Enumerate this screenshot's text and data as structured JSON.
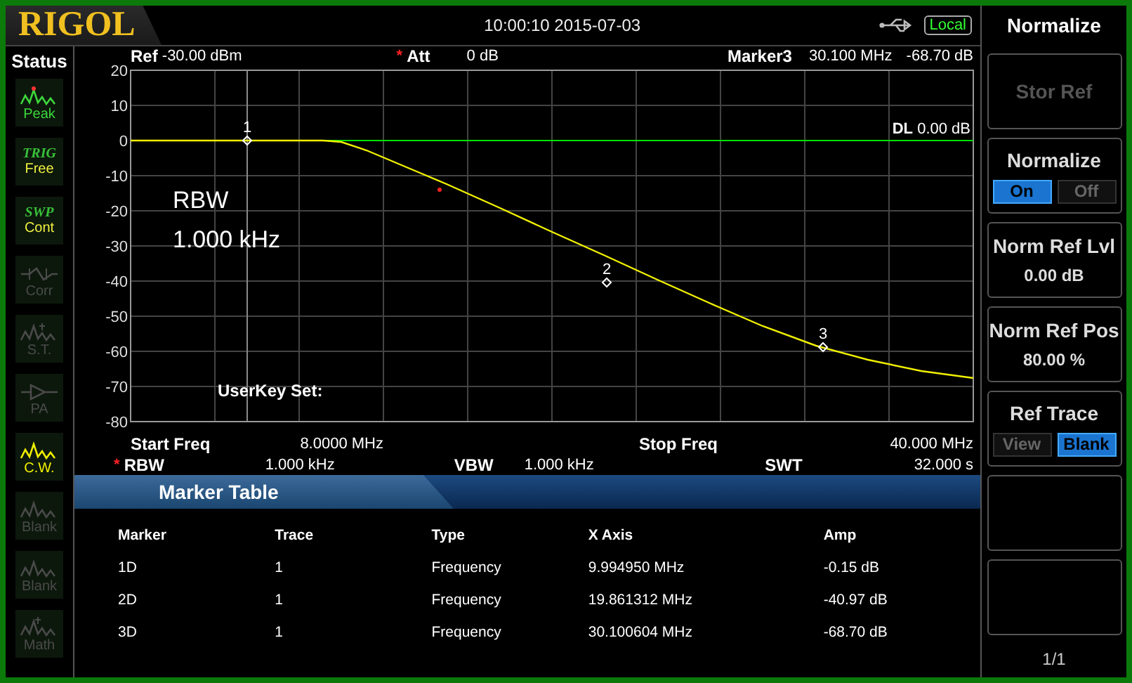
{
  "header": {
    "logo": "RIGOL",
    "datetime": "10:00:10 2015-07-03",
    "remote": "Local"
  },
  "status": {
    "title": "Status",
    "items": [
      {
        "label": "Peak",
        "on": true,
        "color": "#3cd83c"
      },
      {
        "title": "TRIG",
        "label": "Free",
        "on": true,
        "color": "#f0f040"
      },
      {
        "title": "SWP",
        "label": "Cont",
        "on": true,
        "color": "#f0f040"
      },
      {
        "label": "Corr",
        "on": false
      },
      {
        "label": "S.T.",
        "on": false
      },
      {
        "label": "PA",
        "on": false
      },
      {
        "label": "C.W.",
        "on": true,
        "color": "#f0f000"
      },
      {
        "label": "Blank",
        "on": false
      },
      {
        "label": "Blank",
        "on": false
      },
      {
        "label": "Math",
        "on": false
      }
    ]
  },
  "info": {
    "ref_label": "Ref",
    "ref_value": "-30.00 dBm",
    "att_flag": "*",
    "att_label": "Att",
    "att_value": "0 dB",
    "marker_label": "Marker3",
    "marker_x": "30.100 MHz",
    "marker_y": "-68.70 dB"
  },
  "plot": {
    "display_line": {
      "label": "DL",
      "value": "0.00 dB"
    },
    "overlay_lines": [
      "RBW",
      "1.000 kHz"
    ],
    "userkey": "UserKey Set:",
    "y_labels": [
      "20",
      "10",
      "0",
      "-10",
      "-20",
      "-30",
      "-40",
      "-50",
      "-60",
      "-70",
      "-80"
    ],
    "markers": [
      "1",
      "2",
      "3"
    ]
  },
  "freq": {
    "start_label": "Start Freq",
    "start_value": "8.0000 MHz",
    "stop_label": "Stop Freq",
    "stop_value": "40.000 MHz",
    "rbw_flag": "*",
    "rbw_label": "RBW",
    "rbw_value": "1.000 kHz",
    "vbw_label": "VBW",
    "vbw_value": "1.000 kHz",
    "swt_label": "SWT",
    "swt_value": "32.000 s"
  },
  "marker_table": {
    "title": "Marker Table",
    "columns": [
      "Marker",
      "Trace",
      "Type",
      "X Axis",
      "Amp"
    ],
    "rows": [
      [
        "1D",
        "1",
        "Frequency",
        "9.994950 MHz",
        "-0.15 dB"
      ],
      [
        "2D",
        "1",
        "Frequency",
        "19.861312 MHz",
        "-40.97 dB"
      ],
      [
        "3D",
        "1",
        "Frequency",
        "30.100604 MHz",
        "-68.70 dB"
      ]
    ]
  },
  "menu": {
    "title": "Normalize",
    "keys": [
      {
        "kind": "button",
        "label": "Stor Ref",
        "disabled": true
      },
      {
        "kind": "toggle",
        "label": "Normalize",
        "options": [
          {
            "label": "On",
            "selected": true
          },
          {
            "label": "Off",
            "selected": false
          }
        ]
      },
      {
        "kind": "value",
        "label": "Norm Ref Lvl",
        "value": "0.00 dB"
      },
      {
        "kind": "value",
        "label": "Norm Ref Pos",
        "value": "80.00 %"
      },
      {
        "kind": "toggle",
        "label": "Ref Trace",
        "options": [
          {
            "label": "View",
            "selected": false
          },
          {
            "label": "Blank",
            "selected": true
          }
        ]
      },
      {
        "kind": "blank"
      },
      {
        "kind": "blank"
      }
    ],
    "page": "1/1"
  }
}
